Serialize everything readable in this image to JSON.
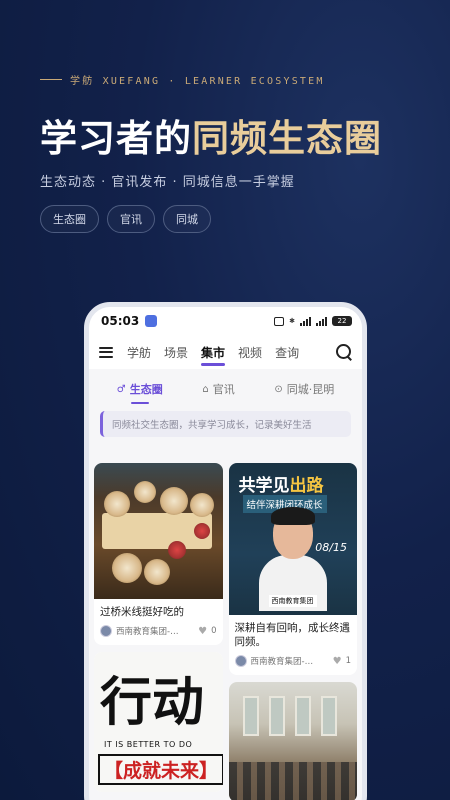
{
  "hero": {
    "kicker": "学舫 XUEFANG · LEARNER ECOSYSTEM",
    "headline_white": "学习者的",
    "headline_gold": "同频生态圈",
    "subline": "生态动态 · 官讯发布 · 同城信息一手掌握",
    "chips": [
      "生态圈",
      "官讯",
      "同城"
    ]
  },
  "status_bar": {
    "time": "05:03",
    "battery": "22"
  },
  "top_nav": {
    "items": [
      "学舫",
      "场景",
      "集市",
      "视频",
      "查询"
    ],
    "active": "集市"
  },
  "sub_tabs": {
    "items": [
      {
        "icon": "♂",
        "label": "生态圈"
      },
      {
        "icon": "⌂",
        "label": "官讯"
      },
      {
        "icon": "⊙",
        "label": "同城·昆明"
      }
    ],
    "active": "生态圈"
  },
  "notice": "同频社交生态圈，共享学习成长，记录美好生活",
  "feed": {
    "left": [
      {
        "caption": "过桥米线挺好吃的",
        "author": "西南教育集团-…",
        "likes": "0"
      },
      {
        "caption": "",
        "author": "",
        "likes": ""
      }
    ],
    "right": [
      {
        "caption": "深耕自有回响，成长终遇同频。",
        "author": "西南教育集团-…",
        "likes": "1"
      },
      {
        "caption": "",
        "author": "",
        "likes": ""
      }
    ]
  },
  "poster": {
    "title_white": "共学见",
    "title_yellow": "出路",
    "subtitle": "结伴深耕闭环成长",
    "date": "08/15",
    "brand": "西南教育集团"
  },
  "calligraphy": {
    "big": "行动",
    "english": "IT IS BETTER TO DO",
    "bottom": "【成就未来】"
  },
  "colors": {
    "accent": "#6b4fd8",
    "gold": "#e9cd9b",
    "bg": "#12214a"
  }
}
